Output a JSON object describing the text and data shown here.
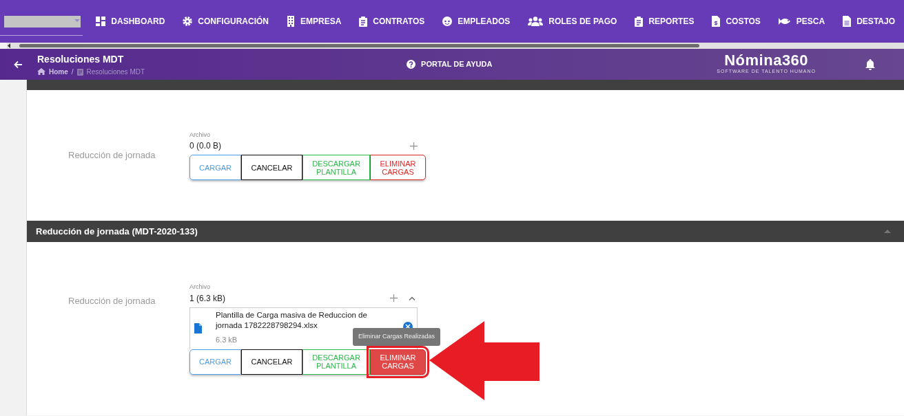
{
  "nav_items": [
    {
      "label": "DASHBOARD",
      "kind": "dashboard"
    },
    {
      "label": "CONFIGURACIÓN",
      "kind": "gear"
    },
    {
      "label": "EMPRESA",
      "kind": "building"
    },
    {
      "label": "CONTRATOS",
      "kind": "clipboard"
    },
    {
      "label": "EMPLEADOS",
      "kind": "face"
    },
    {
      "label": "ROLES DE PAGO",
      "kind": "people"
    },
    {
      "label": "REPORTES",
      "kind": "clipboard"
    },
    {
      "label": "COSTOS",
      "kind": "invoice"
    },
    {
      "label": "PESCA",
      "kind": "fish"
    },
    {
      "label": "DESTAJO",
      "kind": "document"
    }
  ],
  "header": {
    "title": "Resoluciones MDT",
    "separator": "/",
    "breadcrumb": [
      {
        "label": "Home",
        "current": false
      },
      {
        "label": "Resoluciones MDT",
        "current": true
      }
    ],
    "help": "PORTAL DE AYUDA",
    "logo": "Nómina360",
    "tagline": "SOFTWARE DE TALENTO HUMANO"
  },
  "sections": [
    {
      "field_label": "Reducción de jornada",
      "upload": {
        "label": "Archivo",
        "summary": "0 (0.0 B)"
      },
      "buttons": [
        {
          "label": "CARGAR",
          "kind": "upload",
          "hovered": false
        },
        {
          "label": "CANCELAR",
          "kind": "cancel",
          "hovered": false
        },
        {
          "label": "DESCARGAR PLANTILLA",
          "kind": "download",
          "hovered": false
        },
        {
          "label": "ELIMINAR CARGAS",
          "kind": "delete",
          "hovered": false
        }
      ]
    },
    {
      "title": "Reducción de jornada (MDT-2020-133)",
      "expanded": true,
      "field_label": "Reducción de jornada",
      "upload": {
        "label": "Archivo",
        "summary": "1 (6.3 kB)",
        "files_expanded": true,
        "files": [
          {
            "name": "Plantilla de Carga masiva de Reduccion de jornada 1782228798294.xlsx",
            "size": "6.3 kB"
          }
        ]
      },
      "buttons": [
        {
          "label": "CARGAR",
          "kind": "upload",
          "hovered": false
        },
        {
          "label": "CANCELAR",
          "kind": "cancel",
          "hovered": false
        },
        {
          "label": "DESCARGAR PLANTILLA",
          "kind": "download",
          "hovered": false
        },
        {
          "label": "ELIMINAR CARGAS",
          "kind": "delete",
          "hovered": true
        }
      ],
      "tooltip": "Eliminar Cargas Realizadas"
    }
  ]
}
